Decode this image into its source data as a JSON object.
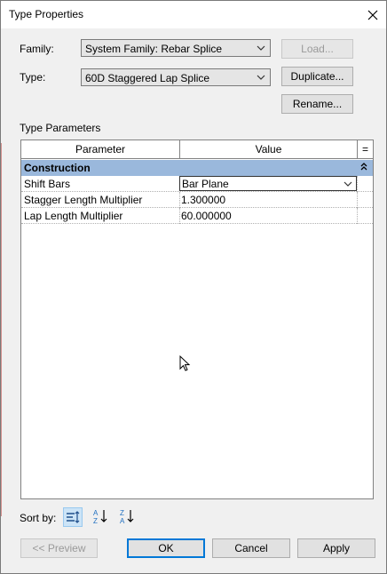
{
  "window": {
    "title": "Type Properties"
  },
  "family": {
    "label": "Family:",
    "value": "System Family: Rebar Splice",
    "load_label": "Load..."
  },
  "type": {
    "label": "Type:",
    "value": "60D Staggered Lap Splice",
    "duplicate_label": "Duplicate...",
    "rename_label": "Rename..."
  },
  "type_parameters": {
    "heading": "Type Parameters",
    "columns": {
      "parameter": "Parameter",
      "value": "Value",
      "extra": "="
    },
    "group": {
      "name": "Construction",
      "collapse_glyph": "⌃"
    },
    "rows": [
      {
        "name": "Shift Bars",
        "value": "Bar Plane"
      },
      {
        "name": "Stagger Length Multiplier",
        "value": "1.300000"
      },
      {
        "name": "Lap Length Multiplier",
        "value": "60.000000"
      }
    ]
  },
  "sort": {
    "label": "Sort by:"
  },
  "footer": {
    "preview_label": "<< Preview",
    "ok_label": "OK",
    "cancel_label": "Cancel",
    "apply_label": "Apply"
  }
}
